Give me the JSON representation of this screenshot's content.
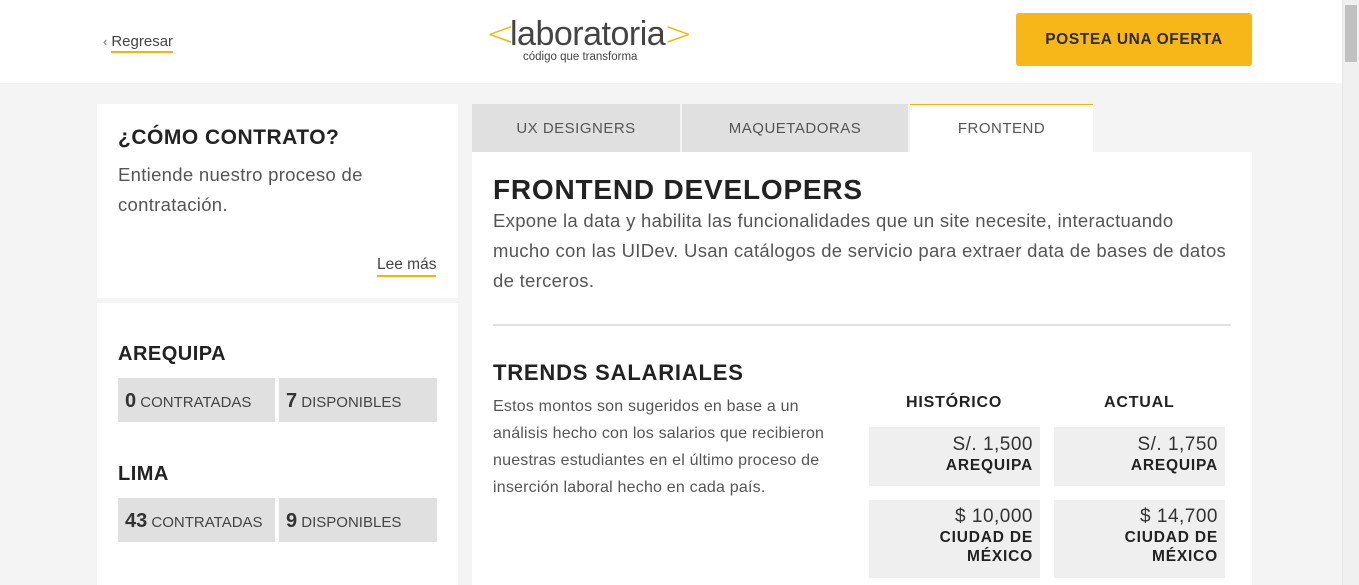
{
  "header": {
    "back_label": "Regresar",
    "logo": {
      "open": "<",
      "word": "laboratoria",
      "close": ">",
      "tagline": "código que transforma"
    },
    "post_button": "POSTEA UNA OFERTA"
  },
  "sidebar": {
    "how_title": "¿CÓMO CONTRATO?",
    "how_text": "Entiende nuestro proceso de contratación.",
    "read_more": "Lee más",
    "cities": [
      {
        "name": "AREQUIPA",
        "hired": "0",
        "hired_label": "CONTRATADAS",
        "available": "7",
        "available_label": "DISPONIBLES"
      },
      {
        "name": "LIMA",
        "hired": "43",
        "hired_label": "CONTRATADAS",
        "available": "9",
        "available_label": "DISPONIBLES"
      }
    ]
  },
  "tabs": [
    {
      "label": "UX DESIGNERS",
      "active": false
    },
    {
      "label": "MAQUETADORAS",
      "active": false
    },
    {
      "label": "FRONTEND",
      "active": true
    }
  ],
  "main": {
    "title": "FRONTEND DEVELOPERS",
    "description": "Expone la data y habilita las funcionalidades que un site necesite, interactuando mucho con las UIDev. Usan catálogos de servicio para extraer data de bases de datos de terceros.",
    "trends_title": "TRENDS SALARIALES",
    "trends_text": "Estos montos son sugeridos en base a un análisis hecho con los salarios que recibieron nuestras estudiantes en el último proceso de inserción laboral hecho en cada país.",
    "col_historic": "HISTÓRICO",
    "col_current": "ACTUAL",
    "salaries": [
      {
        "historic": "S/. 1,500",
        "current": "S/. 1,750",
        "location": "AREQUIPA"
      },
      {
        "historic": "$ 10,000",
        "current": "$ 14,700",
        "location": "CIUDAD DE MÉXICO"
      }
    ]
  },
  "colors": {
    "accent": "#f7b718",
    "tab_bg": "#e0e0e0",
    "page_bg": "#f4f4f4"
  }
}
